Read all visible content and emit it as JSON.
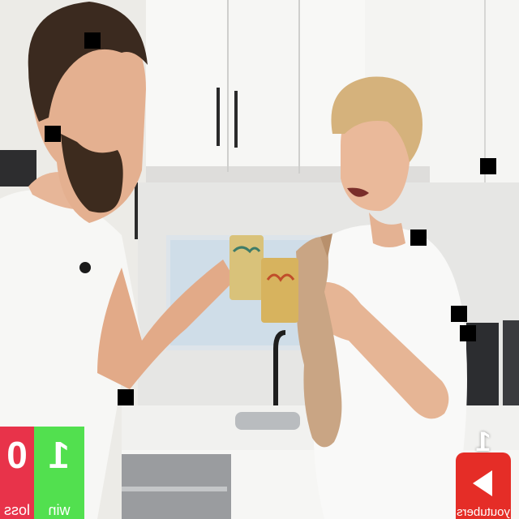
{
  "scoreboard": {
    "loss": {
      "value": "0",
      "label": "loss",
      "color": "#e8334a"
    },
    "win": {
      "value": "1",
      "label": "win",
      "color": "#52e04f"
    }
  },
  "subscribe": {
    "count": "1",
    "label": "youtubers",
    "color": "#e52d27",
    "icon": "youtube-play-icon"
  }
}
